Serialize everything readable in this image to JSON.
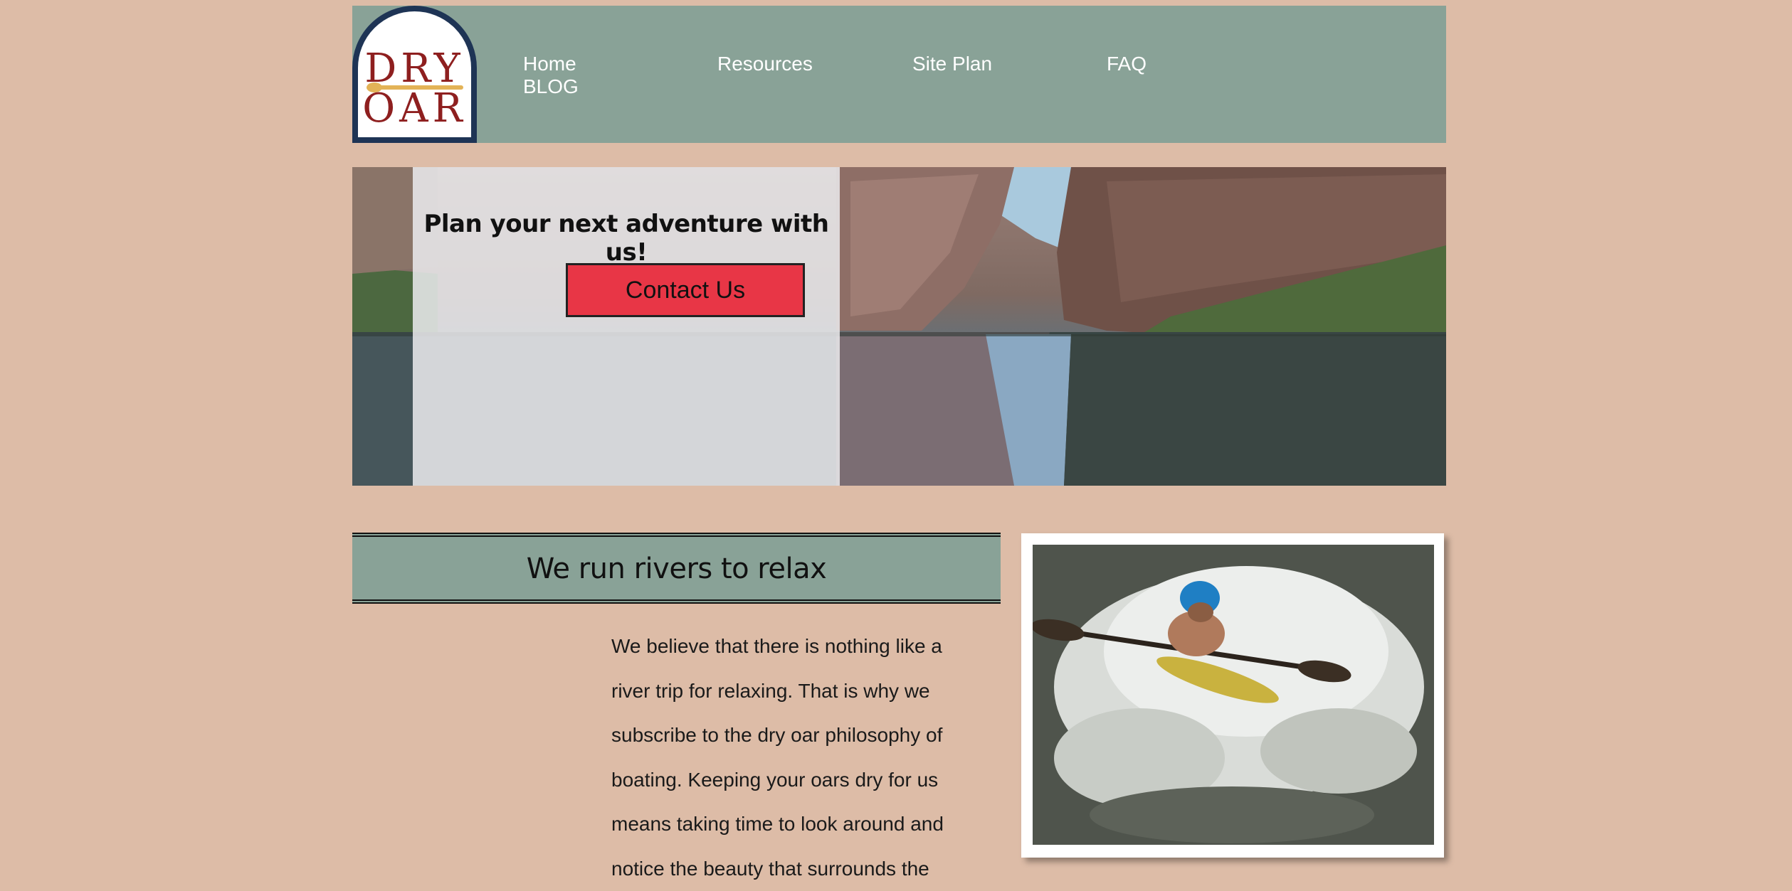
{
  "logo": {
    "line1": "DRY",
    "line2": "OAR"
  },
  "nav": [
    {
      "label": "Home"
    },
    {
      "label": "Resources"
    },
    {
      "label": "Site Plan"
    },
    {
      "label": "FAQ"
    },
    {
      "label": "BLOG"
    }
  ],
  "hero": {
    "heading": "Plan your next adventure with us!",
    "button_label": "Contact Us"
  },
  "section": {
    "title": "We run rivers to relax",
    "body": "We believe that there is nothing like a river trip for relaxing. That is why we subscribe to the dry oar philosophy of boating. Keeping your oars dry for us means taking time to look around and notice the beauty that surrounds the"
  },
  "colors": {
    "background": "#ddbca7",
    "header": "#89a297",
    "button": "#e83646",
    "logo_border": "#1e3455",
    "logo_text": "#8e1f1f"
  }
}
